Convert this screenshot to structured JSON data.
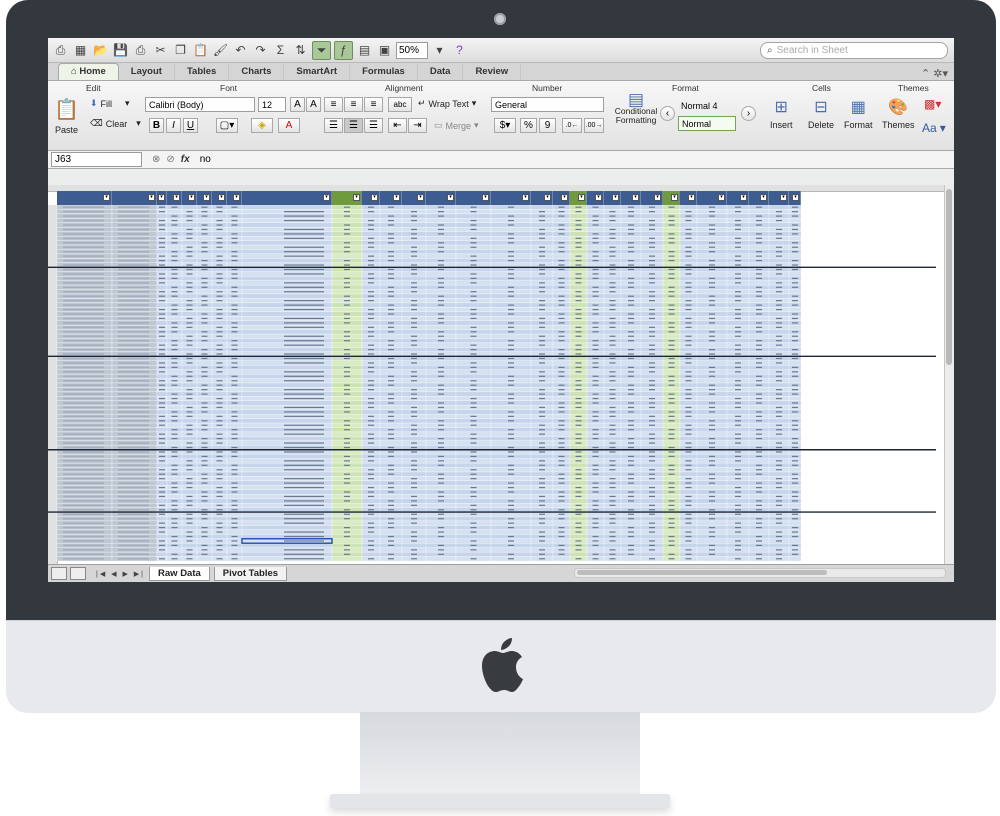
{
  "toolbar": {
    "zoom": "50%",
    "search_placeholder": "Search in Sheet"
  },
  "ribbon_tabs": [
    "Home",
    "Layout",
    "Tables",
    "Charts",
    "SmartArt",
    "Formulas",
    "Data",
    "Review"
  ],
  "ribbon": {
    "groups": {
      "edit": "Edit",
      "font": "Font",
      "alignment": "Alignment",
      "number": "Number",
      "format": "Format",
      "cells": "Cells",
      "themes": "Themes"
    },
    "paste_label": "Paste",
    "fill_label": "Fill",
    "clear_label": "Clear",
    "font_name": "Calibri (Body)",
    "font_size": "12",
    "wrap_text_label": "Wrap Text",
    "merge_label": "Merge",
    "number_format": "General",
    "conditional_formatting_label": "Conditional Formatting",
    "style_normal4": "Normal 4",
    "style_normal": "Normal",
    "insert_label": "Insert",
    "delete_label": "Delete",
    "format_label": "Format",
    "themes_label": "Themes",
    "bold_label": "B",
    "italic_label": "I",
    "underline_label": "U",
    "percent_label": "%",
    "comma_label": "9",
    "text_style_label": "abc",
    "grow_font_label": "A",
    "shrink_font_label": "A",
    "themes_font_label": "Aa"
  },
  "formula_bar": {
    "cell_ref": "J63",
    "fx": "fx",
    "value": "no"
  },
  "sheet_tabs": [
    "Raw Data",
    "Pivot Tables"
  ],
  "colors": {
    "header_blue": "#3d5d92",
    "cell_blue": "#c2d2ea",
    "green_col": "#cfe6b4",
    "active_tab": "#a9c897"
  }
}
